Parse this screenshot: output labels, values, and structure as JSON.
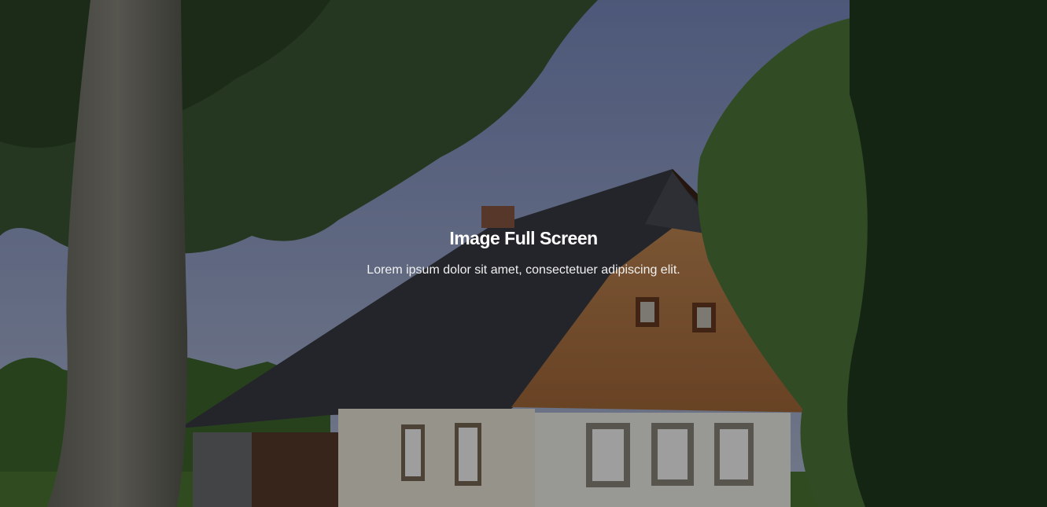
{
  "hero": {
    "title": "Image Full Screen",
    "subtitle": "Lorem ipsum dolor sit amet, consectetuer adipiscing elit.",
    "background_image": "cottage-with-trees-photo",
    "overlay_color": "#000000"
  }
}
